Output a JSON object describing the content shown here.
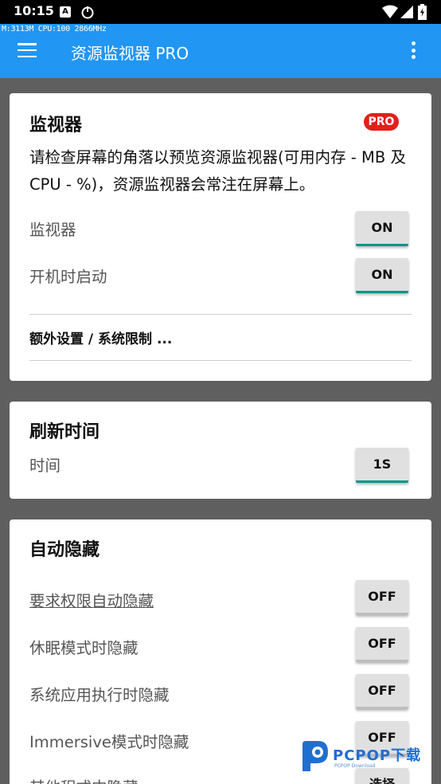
{
  "status_bar": {
    "time": "10:15",
    "a_icon": "A"
  },
  "app_bar": {
    "monitor_overlay": "M:3113M CPU:100 2866MHz",
    "title": "资源监视器 PRO"
  },
  "monitor_card": {
    "title": "监视器",
    "badge": "PRO",
    "description": "请检查屏幕的角落以预览资源监视器(可用内存 - MB 及 CPU - %)，资源监视器会常注在屏幕上。",
    "rows": [
      {
        "label": "监视器",
        "value": "ON"
      },
      {
        "label": "开机时启动",
        "value": "ON"
      }
    ],
    "extra_settings": "额外设置 / 系统限制 ..."
  },
  "refresh_card": {
    "title": "刷新时间",
    "rows": [
      {
        "label": "时间",
        "value": "1S"
      }
    ]
  },
  "autohide_card": {
    "title": "自动隐藏",
    "rows": [
      {
        "label": "要求权限自动隐藏",
        "value": "OFF"
      },
      {
        "label": "休眠模式时隐藏",
        "value": "OFF"
      },
      {
        "label": "系统应用执行时隐藏",
        "value": "OFF"
      },
      {
        "label": "Immersive模式时隐藏",
        "value": "OFF"
      },
      {
        "label": "其他程式中隐藏",
        "value": "选择"
      }
    ]
  },
  "watermark": {
    "brand": "PCPOP下载",
    "sub": "PCPOP Download"
  },
  "colors": {
    "appbar": "#2196f3",
    "accent": "#009688",
    "badge": "#e0201b",
    "background": "#5f5f5f"
  }
}
